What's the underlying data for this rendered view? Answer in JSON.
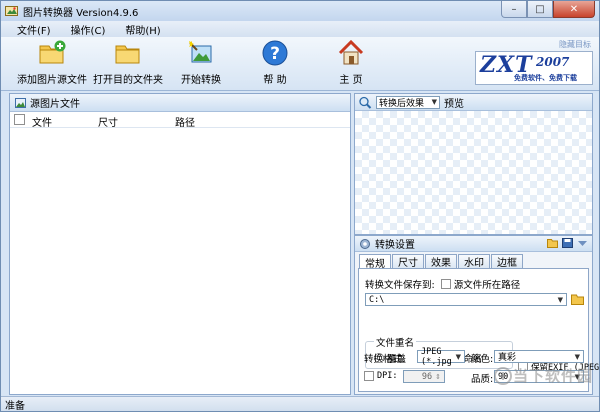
{
  "window": {
    "title": "图片转换器 Version4.9.6"
  },
  "menu": [
    "文件(F)",
    "操作(C)",
    "帮助(H)"
  ],
  "toolbar": {
    "add_label": "添加图片源文件",
    "open_label": "打开目的文件夹",
    "start_label": "开始转换",
    "help_label": "帮 助",
    "home_label": "主 页"
  },
  "logo": {
    "brand": "ZXT",
    "year": "2007",
    "slogan": "免费软件、免费下载",
    "tag": "隐藏目标"
  },
  "left_panel": {
    "title": "源图片文件",
    "columns": [
      "文件",
      "尺寸",
      "路径"
    ]
  },
  "preview": {
    "mode": "转换后效果",
    "label": "预览"
  },
  "settings": {
    "title": "转换设置",
    "tabs": [
      "常规",
      "尺寸",
      "效果",
      "水印",
      "边框"
    ],
    "save_to_label": "转换文件保存到:",
    "source_path_label": "源文件所在路径",
    "save_path": "C:\\",
    "rename_group": "文件重名",
    "overwrite_label": "覆盖",
    "auto_rename_label": "自动重命名",
    "keep_exif_label": "保留EXIF (JPEG)",
    "format_label": "转换格式:",
    "format_value": "JPEG (*.jpg",
    "color_label": "颜色:",
    "color_value": "真彩",
    "dpi_label": "DPI:",
    "dpi_value": "96",
    "quality_label": "品质:",
    "quality_value": "90"
  },
  "status": {
    "text": "准备"
  },
  "watermark": {
    "text": "当下软件园"
  }
}
